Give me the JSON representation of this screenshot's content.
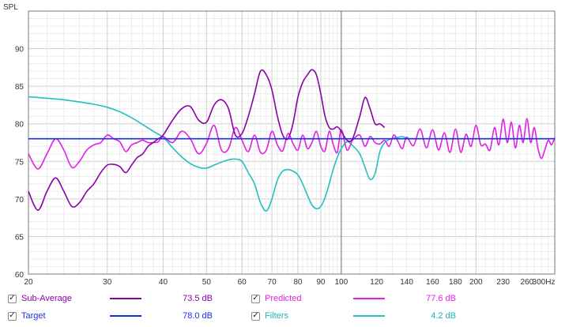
{
  "chart_data": {
    "type": "line",
    "ylabel": "SPL",
    "xlabel": "",
    "xunit": "Hz",
    "xscale": "log",
    "xlim": [
      20,
      300
    ],
    "ylim": [
      60,
      95
    ],
    "grid": true,
    "xticks": [
      20,
      30,
      40,
      50,
      60,
      70,
      80,
      90,
      100,
      120,
      140,
      160,
      180,
      200,
      230,
      260,
      300
    ],
    "xtick_labels": [
      "20",
      "30",
      "40",
      "50",
      "60",
      "70",
      "80",
      "90",
      "100",
      "120",
      "140",
      "160",
      "180",
      "200",
      "230",
      "260",
      "300Hz"
    ],
    "yticks": [
      60,
      65,
      70,
      75,
      80,
      85,
      90
    ],
    "marker_x": 100,
    "series": [
      {
        "name": "Sub-Average",
        "color": "#8a00a8",
        "value_label": "73.5 dB",
        "checked": true,
        "x": [
          20,
          21,
          22,
          23,
          24,
          25,
          26,
          27,
          28,
          29,
          30,
          31,
          32,
          33,
          34,
          35,
          36,
          37,
          38,
          39,
          40,
          42,
          44,
          46,
          48,
          50,
          52,
          54,
          56,
          58,
          60,
          62,
          64,
          66,
          68,
          70,
          72,
          74,
          76,
          78,
          80,
          82,
          84,
          86,
          88,
          90,
          92,
          94,
          96,
          98,
          100,
          103,
          106,
          110,
          113,
          116,
          119,
          122,
          125
        ],
        "y": [
          71,
          68.5,
          71,
          72.8,
          71,
          69,
          69.5,
          71,
          72,
          73.5,
          74.5,
          74.6,
          74.3,
          73.5,
          74.5,
          75.5,
          76,
          77,
          77.5,
          78,
          78.5,
          80.5,
          82,
          82.3,
          80.5,
          80.2,
          82.5,
          83.2,
          82,
          78.5,
          78.7,
          81,
          84,
          87,
          86.5,
          84.5,
          81,
          78.5,
          78,
          80,
          83.5,
          85.5,
          86.5,
          87.2,
          86.5,
          84,
          81,
          79.5,
          79.3,
          79.6,
          79,
          77.8,
          78,
          81,
          83.5,
          82,
          80,
          80,
          79.5
        ]
      },
      {
        "name": "Predicted",
        "color": "#e020e6",
        "value_label": "77.6 dB",
        "checked": true,
        "x": [
          20,
          21,
          22,
          23,
          24,
          25,
          26,
          27,
          28,
          29,
          30,
          31,
          32,
          33,
          34,
          35,
          36,
          37,
          38,
          39,
          40,
          42,
          44,
          46,
          48,
          50,
          52,
          54,
          56,
          58,
          60,
          62,
          64,
          66,
          68,
          70,
          72,
          74,
          76,
          78,
          80,
          82,
          84,
          86,
          88,
          90,
          92,
          94,
          96,
          98,
          100,
          103,
          106,
          110,
          113,
          116,
          119,
          122,
          125,
          128,
          131,
          134,
          137,
          140,
          145,
          150,
          155,
          160,
          165,
          170,
          175,
          180,
          185,
          190,
          195,
          200,
          205,
          210,
          215,
          220,
          225,
          230,
          235,
          240,
          245,
          250,
          255,
          260,
          265,
          270,
          275,
          280,
          285,
          290,
          295,
          300
        ],
        "y": [
          76,
          74,
          76,
          78,
          76.5,
          74.2,
          75,
          76.5,
          77.2,
          77.5,
          78.5,
          78,
          77.6,
          76.3,
          77.2,
          77.5,
          77.8,
          77.5,
          77.5,
          77.6,
          78.3,
          77.5,
          79,
          78,
          76,
          77.4,
          79.8,
          76.5,
          76.7,
          79.5,
          77.8,
          76.3,
          78.5,
          76.2,
          76.5,
          79,
          77.2,
          76.4,
          78.7,
          77.4,
          76.5,
          78.5,
          76.7,
          77.5,
          79,
          77,
          76.4,
          79,
          77.2,
          76.2,
          79.2,
          76.5,
          77.8,
          78.5,
          77,
          78.3,
          77.5,
          77.3,
          77.8,
          77,
          78.5,
          77.6,
          76.7,
          78.2,
          77.1,
          79.3,
          76.8,
          79.2,
          76.5,
          78.8,
          76.2,
          79.3,
          76.2,
          78.6,
          77,
          79.8,
          77.2,
          77.3,
          76.5,
          79.5,
          77.2,
          80.6,
          77.5,
          80.2,
          76.8,
          79.8,
          77.5,
          80.7,
          77.5,
          79.5,
          76.8,
          75.4,
          76.5,
          77.8,
          77.2,
          78.2
        ]
      },
      {
        "name": "Target",
        "color": "#1a2ee8",
        "value_label": "78.0 dB",
        "checked": true,
        "x": [
          20,
          300
        ],
        "y": [
          78,
          78
        ]
      },
      {
        "name": "Filters",
        "color": "#22c0c0",
        "value_label": "4.2 dB",
        "checked": true,
        "x": [
          20,
          22,
          24,
          26,
          28,
          30,
          32,
          34,
          36,
          38,
          40,
          42,
          44,
          46,
          48,
          50,
          52,
          54,
          56,
          58,
          60,
          62,
          64,
          66,
          68,
          70,
          72,
          74,
          76,
          78,
          80,
          82,
          84,
          86,
          88,
          90,
          92,
          94,
          96,
          98,
          100,
          103,
          106,
          110,
          113,
          116,
          119,
          122,
          125,
          128,
          131,
          134,
          137,
          140,
          145,
          150,
          160,
          170,
          180,
          200,
          230,
          260,
          300
        ],
        "y": [
          83.6,
          83.4,
          83.2,
          82.9,
          82.6,
          82.2,
          81.6,
          80.8,
          79.9,
          79,
          78.2,
          76.8,
          75.6,
          74.7,
          74.2,
          74.1,
          74.5,
          74.9,
          75.2,
          75.3,
          75,
          73.5,
          72,
          69.5,
          68.4,
          70,
          72.5,
          73.7,
          73.9,
          73.7,
          73.2,
          72,
          70.5,
          69.2,
          68.7,
          69,
          70.2,
          72,
          74,
          75.5,
          76.7,
          77.6,
          77.1,
          76,
          74.2,
          72.6,
          73.4,
          76.3,
          77.5,
          77.9,
          78.1,
          78.2,
          78.3,
          78.1,
          78,
          78,
          78,
          78,
          78,
          78,
          78,
          78,
          78
        ]
      }
    ]
  }
}
